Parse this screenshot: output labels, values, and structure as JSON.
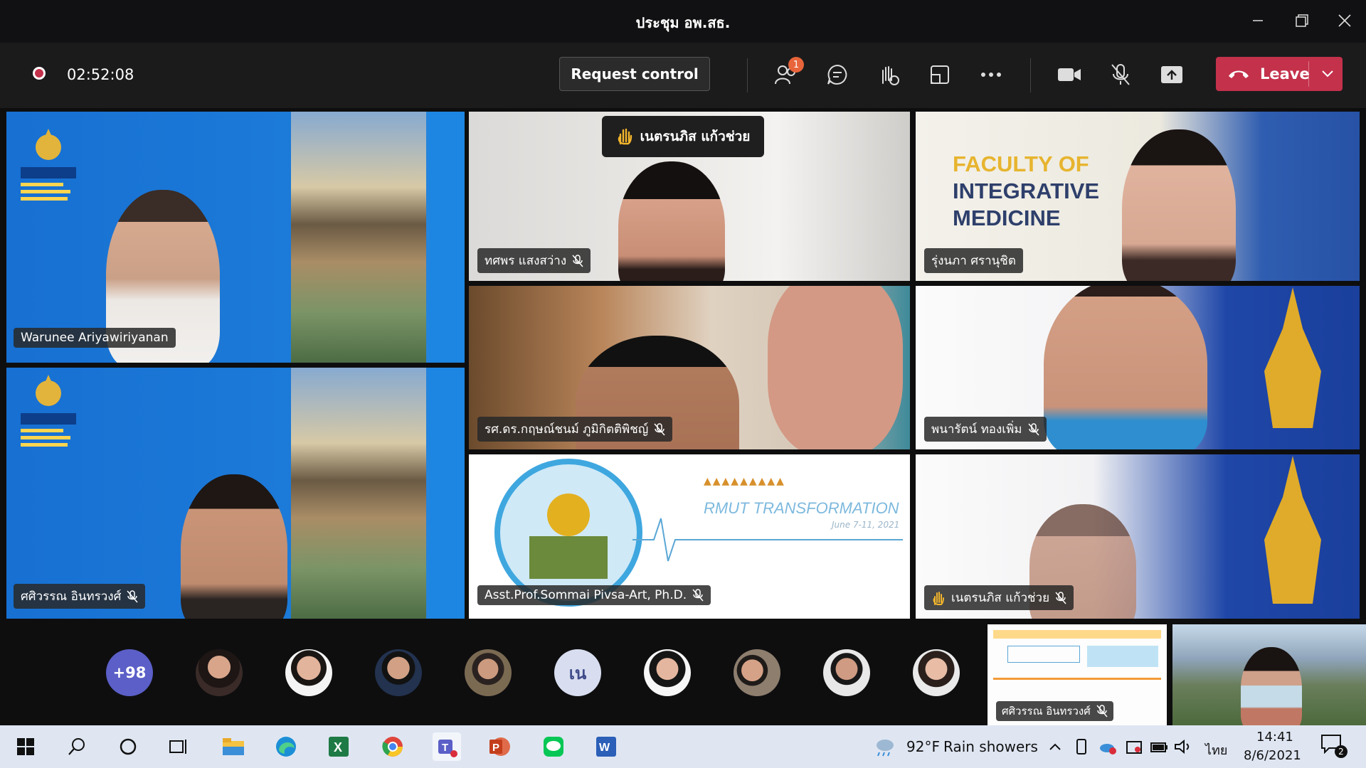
{
  "window": {
    "title": "ประชุม อพ.สธ.",
    "minimize_icon": "minimize-icon",
    "restore_icon": "restore-icon",
    "close_icon": "close-icon"
  },
  "toolbar": {
    "record_icon": "recording-icon",
    "timer": "02:52:08",
    "request_control_label": "Request control",
    "participants_badge": "1",
    "leave_label": "Leave",
    "accent": "#c4314b"
  },
  "tiles": {
    "t1": {
      "name": "Warunee Ariyawiriyanan"
    },
    "t2": {
      "name": "ศศิวรรณ อินทรวงศ์"
    },
    "t3": {
      "name": "ทศพร แสงสว่าง"
    },
    "t4": {
      "name": "รุ่งนภา ศรานุชิต"
    },
    "t5": {
      "name": "รศ.ดร.กฤษณ์ชนม์ ภูมิกิตติพิชญ์"
    },
    "t6": {
      "name": "พนารัตน์ ทองเพิ่ม"
    },
    "t7": {
      "name": "Asst.Prof.Sommai Pivsa-Art, Ph.D."
    },
    "t8": {
      "name": "เนตรนภิส แก้วช่วย"
    }
  },
  "tile_texts": {
    "faculty_line1": "FACULTY OF",
    "faculty_line2": "INTEGRATIVE",
    "faculty_line3": "MEDICINE",
    "rmut_transformation": "RMUT TRANSFORMATION",
    "rmut_date": "June 7-11, 2021"
  },
  "raised_hand_banner": "เนตรนภิส แก้วช่วย",
  "participants_strip": {
    "overflow_count": "+98",
    "initials_avatar": "เน",
    "shared_tile_name": "ศศิวรรณ อินทรวงศ์"
  },
  "taskbar": {
    "weather_temp": "92°F",
    "weather_text": "Rain showers",
    "language": "ไทย",
    "time": "14:41",
    "date": "8/6/2021",
    "notification_count": "2"
  }
}
